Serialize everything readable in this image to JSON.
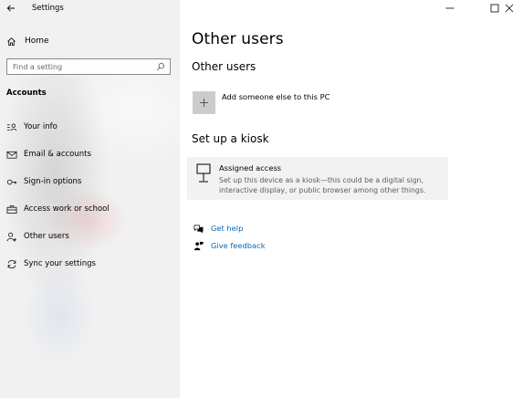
{
  "window": {
    "title": "Settings",
    "controls": {
      "minimize_icon": "minimize-icon",
      "maximize_icon": "maximize-icon",
      "close_icon": "close-icon"
    }
  },
  "sidebar": {
    "home": {
      "label": "Home",
      "icon": "home-icon"
    },
    "search": {
      "placeholder": "Find a setting",
      "icon": "search-icon"
    },
    "section": "Accounts",
    "items": [
      {
        "label": "Your info",
        "icon": "person-card-icon"
      },
      {
        "label": "Email & accounts",
        "icon": "mail-icon"
      },
      {
        "label": "Sign-in options",
        "icon": "key-icon"
      },
      {
        "label": "Access work or school",
        "icon": "briefcase-icon"
      },
      {
        "label": "Other users",
        "icon": "people-icon"
      },
      {
        "label": "Sync your settings",
        "icon": "sync-icon"
      }
    ]
  },
  "main": {
    "page_title": "Other users",
    "other_users": {
      "heading": "Other users",
      "add_label": "Add someone else to this PC"
    },
    "kiosk": {
      "heading": "Set up a kiosk",
      "title": "Assigned access",
      "description": "Set up this device as a kiosk—this could be a digital sign, interactive display, or public browser among other things."
    },
    "links": {
      "help": "Get help",
      "feedback": "Give feedback"
    }
  },
  "colors": {
    "link": "#0a67b8",
    "sidebar_bg": "#f1f1f1",
    "add_tile": "#cccccc",
    "card_bg": "#f2f2f2"
  }
}
